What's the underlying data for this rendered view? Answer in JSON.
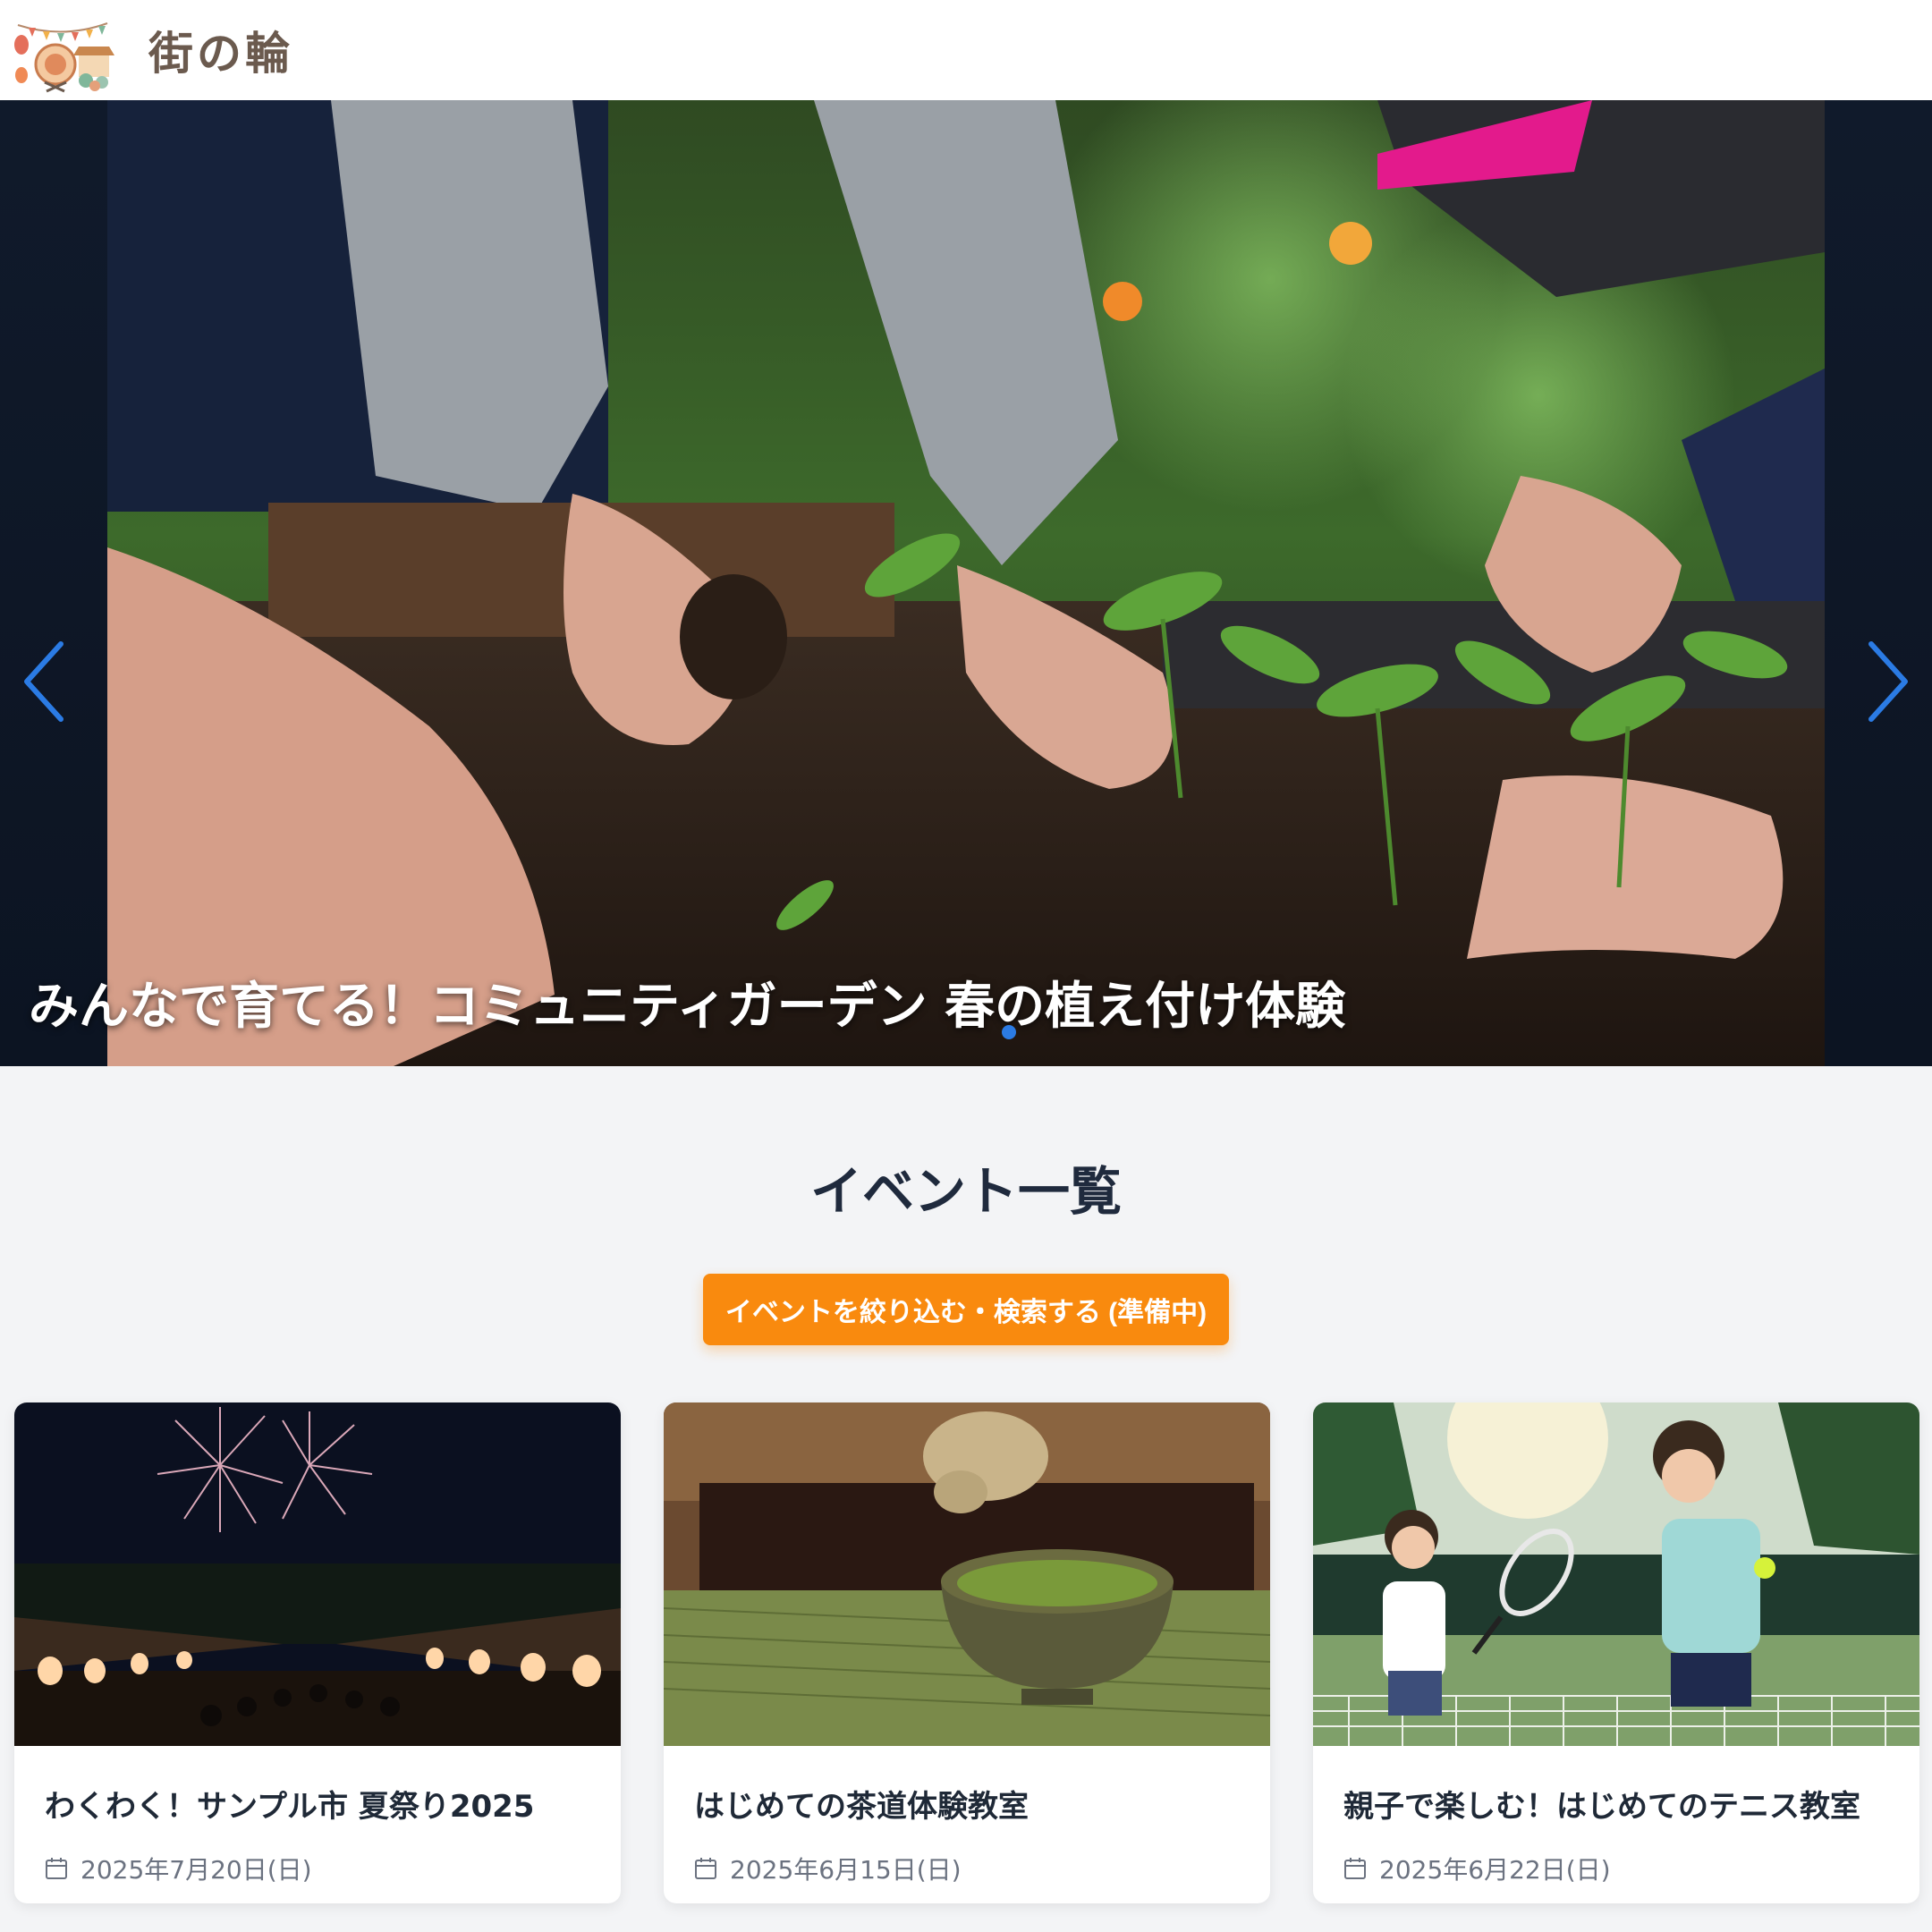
{
  "header": {
    "site_name": "街の輪",
    "logo_icon": "festival-logo-icon"
  },
  "hero": {
    "title": "みんなで育てる！コミュニティガーデン 春の植え付け体験",
    "prev_icon": "chevron-left-icon",
    "next_icon": "chevron-right-icon",
    "active_dot": 1,
    "dot_count": 1
  },
  "events": {
    "heading": "イベント一覧",
    "filter_button": "イベントを絞り込む・検索する (準備中)",
    "cards": [
      {
        "title": "わくわく！サンプル市 夏祭り2025",
        "date": "2025年7月20日(日)",
        "image": "fireworks-festival-photo"
      },
      {
        "title": "はじめての茶道体験教室",
        "date": "2025年6月15日(日)",
        "image": "matcha-tea-photo"
      },
      {
        "title": "親子で楽しむ！はじめてのテニス教室",
        "date": "2025年6月22日(日)",
        "image": "tennis-lesson-photo"
      }
    ]
  },
  "colors": {
    "accent_orange": "#f98a0e",
    "arrow_blue": "#2b7be4",
    "heading_dark": "#1f2a3d"
  }
}
